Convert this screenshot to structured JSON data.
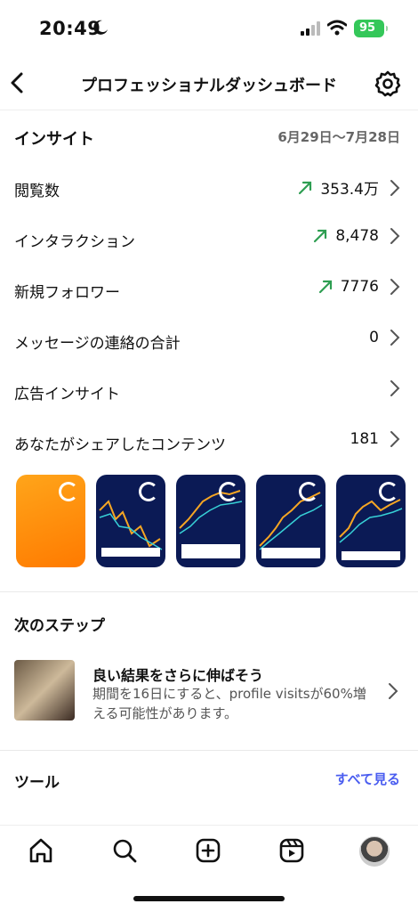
{
  "status": {
    "time": "20:49",
    "battery": "95"
  },
  "header": {
    "title": "プロフェッショナルダッシュボード"
  },
  "insights": {
    "title": "インサイト",
    "date_range": "6月29日〜7月28日",
    "rows": [
      {
        "label": "閲覧数",
        "value": "353.4万",
        "trend": "up"
      },
      {
        "label": "インタラクション",
        "value": "8,478",
        "trend": "up"
      },
      {
        "label": "新規フォロワー",
        "value": "7776",
        "trend": "up"
      },
      {
        "label": "メッセージの連絡の合計",
        "value": "0"
      },
      {
        "label": "広告インサイト",
        "value": ""
      },
      {
        "label": "あなたがシェアしたコンテンツ",
        "value": "181"
      }
    ]
  },
  "next_steps": {
    "title": "次のステップ",
    "item_title": "良い結果をさらに伸ばそう",
    "item_desc": "期間を16日にすると、profile visitsが60%増える可能性があります。"
  },
  "tools": {
    "title": "ツール",
    "see_all": "すべて見る"
  },
  "colors": {
    "trend_green": "#2e9e52",
    "link_blue": "#4a5df0",
    "battery_green": "#34c759"
  }
}
